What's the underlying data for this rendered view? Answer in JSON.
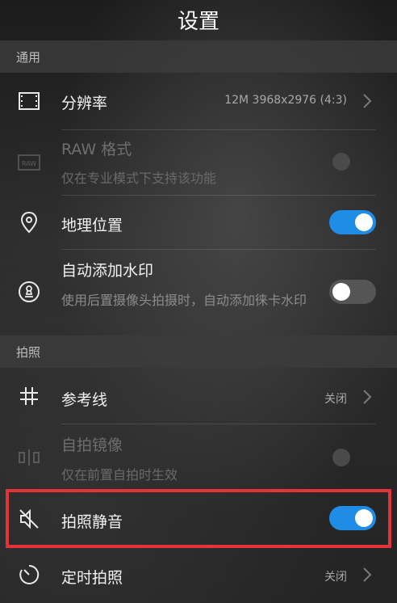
{
  "header": {
    "title": "设置"
  },
  "sections": {
    "general": "通用",
    "photo": "拍照"
  },
  "settings": {
    "resolution": {
      "label": "分辨率",
      "value": "12M 3968x2976 (4:3)",
      "icon": "resolution-icon"
    },
    "raw": {
      "label": "RAW 格式",
      "description": "仅在专业模式下支持该功能",
      "enabled": false,
      "toggle": "disabled"
    },
    "location": {
      "label": "地理位置",
      "toggle": "on"
    },
    "watermark": {
      "label": "自动添加水印",
      "description": "使用后置摄像头拍摄时，自动添加徕卡水印",
      "toggle": "off"
    },
    "grid": {
      "label": "参考线",
      "value": "关闭"
    },
    "mirror": {
      "label": "自拍镜像",
      "description": "仅在前置自拍时生效",
      "enabled": false,
      "toggle": "disabled"
    },
    "mute": {
      "label": "拍照静音",
      "toggle": "on",
      "highlighted": true
    },
    "timer": {
      "label": "定时拍照",
      "value": "关闭"
    }
  },
  "colors": {
    "accent": "#1f8ce6",
    "highlight": "#e2333a",
    "background": "#2a2a2a"
  }
}
